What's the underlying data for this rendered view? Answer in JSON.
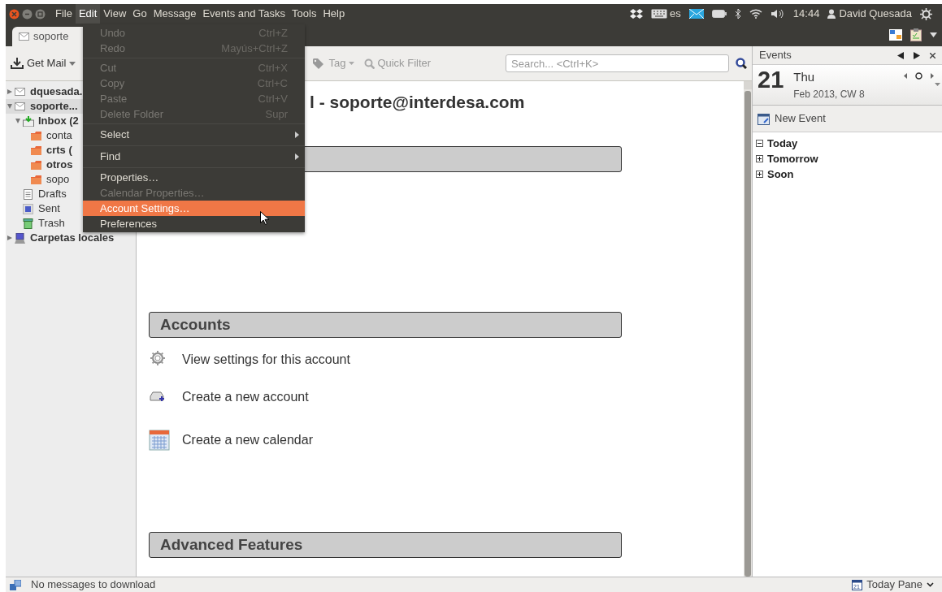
{
  "top_panel": {
    "menus": [
      {
        "label": "File",
        "selected": false
      },
      {
        "label": "Edit",
        "selected": true
      },
      {
        "label": "View",
        "selected": false
      },
      {
        "label": "Go",
        "selected": false
      },
      {
        "label": "Message",
        "selected": false
      },
      {
        "label": "Events and Tasks",
        "selected": false
      },
      {
        "label": "Tools",
        "selected": false
      },
      {
        "label": "Help",
        "selected": false
      }
    ],
    "language": "es",
    "time": "14:44",
    "user": "David Quesada"
  },
  "tab": {
    "label": "soporte"
  },
  "toolbar": {
    "get_mail": "Get Mail",
    "tag": "Tag",
    "quick_filter": "Quick Filter",
    "search": {
      "placeholder": "Search... <Ctrl+K>"
    }
  },
  "folders": [
    {
      "label": "dquesada.",
      "kind": "account",
      "bold": true,
      "expanded": false,
      "selected": false
    },
    {
      "label": "soporte...",
      "kind": "account",
      "bold": true,
      "expanded": true,
      "selected": true,
      "children": [
        {
          "label": "Inbox (2",
          "kind": "inbox",
          "bold": true,
          "expanded": true,
          "selected": false,
          "children": [
            {
              "label": "conta",
              "kind": "folder",
              "bold": false,
              "selected": false
            },
            {
              "label": "crts (",
              "kind": "folder",
              "bold": true,
              "selected": false
            },
            {
              "label": "otros",
              "kind": "folder",
              "bold": true,
              "selected": false
            },
            {
              "label": "sopo",
              "kind": "folder",
              "bold": false,
              "selected": false
            }
          ]
        },
        {
          "label": "Drafts",
          "kind": "drafts",
          "bold": false,
          "selected": false
        },
        {
          "label": "Sent",
          "kind": "sent",
          "bold": false,
          "selected": false
        },
        {
          "label": "Trash",
          "kind": "trash",
          "bold": false,
          "selected": false
        }
      ]
    },
    {
      "label": "Carpetas locales",
      "kind": "local",
      "bold": true,
      "expanded": false,
      "selected": false
    }
  ],
  "edit_menu": [
    {
      "kind": "item",
      "label": "Undo",
      "shortcut": "Ctrl+Z",
      "disabled": true,
      "selected": false
    },
    {
      "kind": "item",
      "label": "Redo",
      "shortcut": "Mayús+Ctrl+Z",
      "disabled": true,
      "selected": false
    },
    {
      "kind": "separator"
    },
    {
      "kind": "item",
      "label": "Cut",
      "shortcut": "Ctrl+X",
      "disabled": true,
      "selected": false
    },
    {
      "kind": "item",
      "label": "Copy",
      "shortcut": "Ctrl+C",
      "disabled": true,
      "selected": false
    },
    {
      "kind": "item",
      "label": "Paste",
      "shortcut": "Ctrl+V",
      "disabled": true,
      "selected": false
    },
    {
      "kind": "item",
      "label": "Delete Folder",
      "shortcut": "Supr",
      "disabled": true,
      "selected": false
    },
    {
      "kind": "separator"
    },
    {
      "kind": "submenu",
      "label": "Select",
      "disabled": false,
      "selected": false
    },
    {
      "kind": "separator"
    },
    {
      "kind": "submenu",
      "label": "Find",
      "disabled": false,
      "selected": false
    },
    {
      "kind": "separator"
    },
    {
      "kind": "item",
      "label": "Properties…",
      "disabled": false,
      "selected": false
    },
    {
      "kind": "item",
      "label": "Calendar Properties…",
      "disabled": true,
      "selected": false
    },
    {
      "kind": "item",
      "label": "Account Settings…",
      "disabled": false,
      "selected": true
    },
    {
      "kind": "item",
      "label": "Preferences",
      "disabled": false,
      "selected": false
    }
  ],
  "content": {
    "heading": "l - soporte@interdesa.com",
    "sections": [
      {
        "title": "Accounts",
        "items": [
          {
            "kind": "gear",
            "label": "View settings for this account"
          },
          {
            "kind": "account-add",
            "label": "Create a new account"
          },
          {
            "kind": "calendar",
            "label": "Create a new calendar"
          }
        ]
      },
      {
        "title": "Advanced Features"
      }
    ]
  },
  "today_pane": {
    "title": "Events",
    "day": "21",
    "weekday": "Thu",
    "month_line": "Feb 2013, CW 8",
    "new_event": "New Event",
    "groups": [
      {
        "label": "Today",
        "expanded": true
      },
      {
        "label": "Tomorrow",
        "expanded": false
      },
      {
        "label": "Soon",
        "expanded": false
      }
    ]
  },
  "status_bar": {
    "message": "No messages to download",
    "today_pane": "Today Pane",
    "today_icon_day": "21"
  }
}
